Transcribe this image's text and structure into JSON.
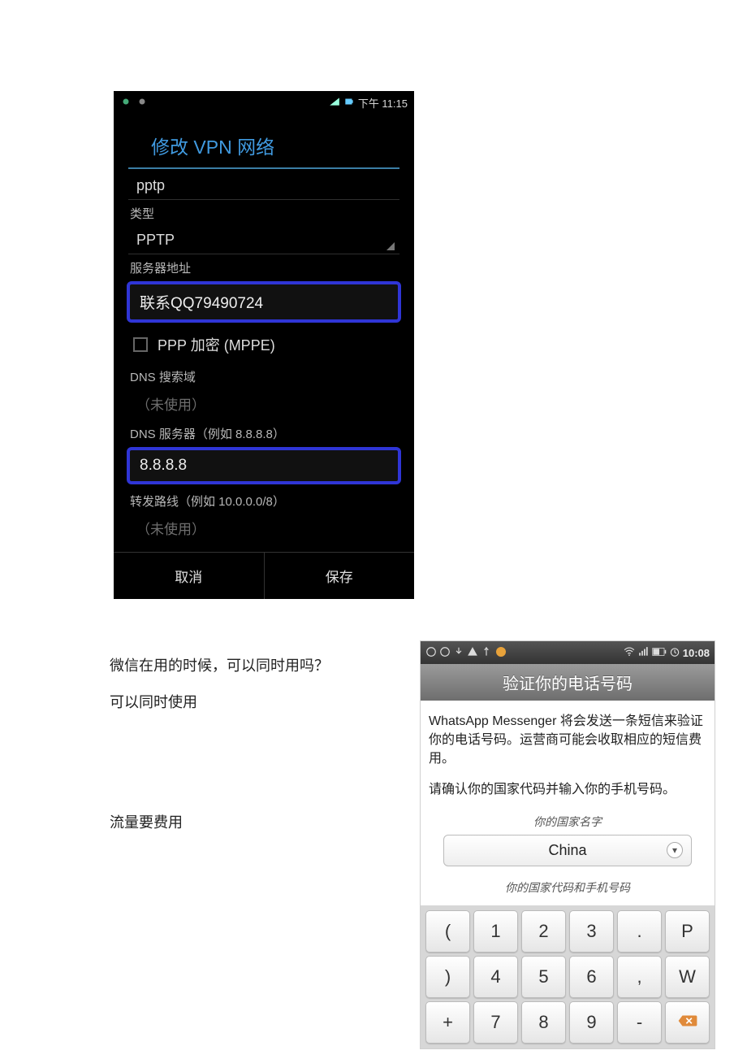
{
  "phone1": {
    "status": {
      "time": "下午 11:15"
    },
    "header": "修改 VPN 网络",
    "name_value": "pptp",
    "type_label": "类型",
    "type_value": "PPTP",
    "server_label": "服务器地址",
    "server_value": "联系QQ79490724",
    "ppp_label": "PPP 加密 (MPPE)",
    "dns_search_label": "DNS 搜索域",
    "dns_search_placeholder": "（未使用）",
    "dns_server_label": "DNS 服务器（例如 8.8.8.8）",
    "dns_server_value": "8.8.8.8",
    "route_label": "转发路线（例如 10.0.0.0/8）",
    "route_placeholder": "（未使用）",
    "cancel": "取消",
    "save": "保存"
  },
  "doc": {
    "q1": "微信在用的时候，可以同时用吗？",
    "a1": "可以同时使用",
    "note": "流量要费用"
  },
  "phone2": {
    "status": {
      "time": "10:08"
    },
    "title": "验证你的电话号码",
    "para1": "WhatsApp Messenger 将会发送一条短信来验证你的电话号码。运营商可能会收取相应的短信费用。",
    "para2": "请确认你的国家代码并输入你的手机号码。",
    "hint1": "你的国家名字",
    "country": "China",
    "hint2": "你的国家代码和手机号码",
    "keys_row1": [
      "(",
      "1",
      "2",
      "3",
      ".",
      "P"
    ],
    "keys_row2": [
      ")",
      "4",
      "5",
      "6",
      ",",
      "W"
    ],
    "keys_row3": [
      "+",
      "7",
      "8",
      "9",
      "-",
      "⌫"
    ]
  }
}
